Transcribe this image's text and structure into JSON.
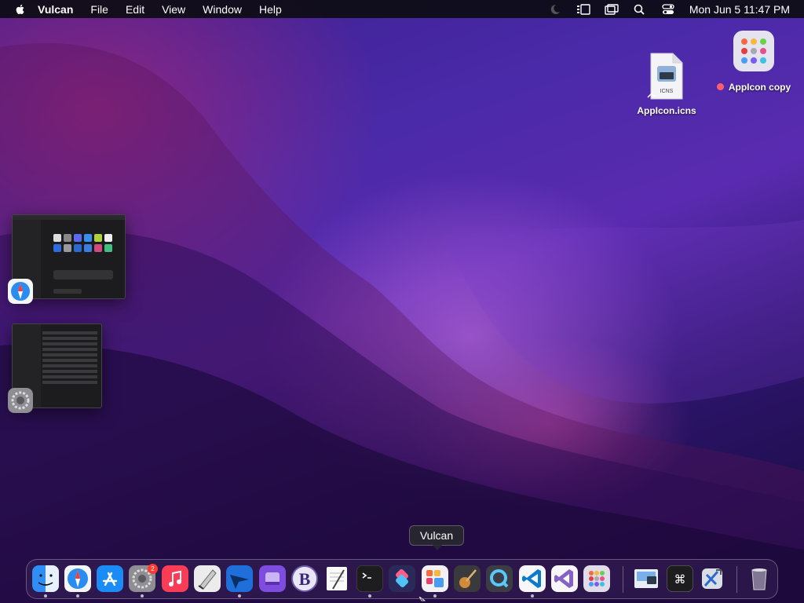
{
  "menubar": {
    "app_name": "Vulcan",
    "menus": [
      "File",
      "Edit",
      "View",
      "Window",
      "Help"
    ],
    "clock": "Mon Jun 5  11:47 PM"
  },
  "desktop": {
    "icons": [
      {
        "label": "AppIcon.icns",
        "file_tag": "ICNS"
      },
      {
        "label": "AppIcon copy"
      }
    ]
  },
  "tooltip": "Vulcan",
  "dock": {
    "settings_badge": "2",
    "items": [
      "finder-icon",
      "safari-icon",
      "app-store-icon",
      "system-settings-icon",
      "music-icon",
      "script-editor-icon",
      "xcode-instruments-icon",
      "disk-utility-icon",
      "bbedit-icon",
      "textedit-icon",
      "terminal-icon",
      "shortcuts-icon",
      "vulcan-icon",
      "garageband-icon",
      "quicktime-icon",
      "vscode-icon",
      "visual-studio-icon",
      "launchpad-icon",
      "preview-icon",
      "keyboard-shortcut-icon",
      "xcode-icon",
      "trash-icon"
    ]
  },
  "colors": {
    "accent": "#5a2bb0",
    "badge": "#ff3b30"
  }
}
